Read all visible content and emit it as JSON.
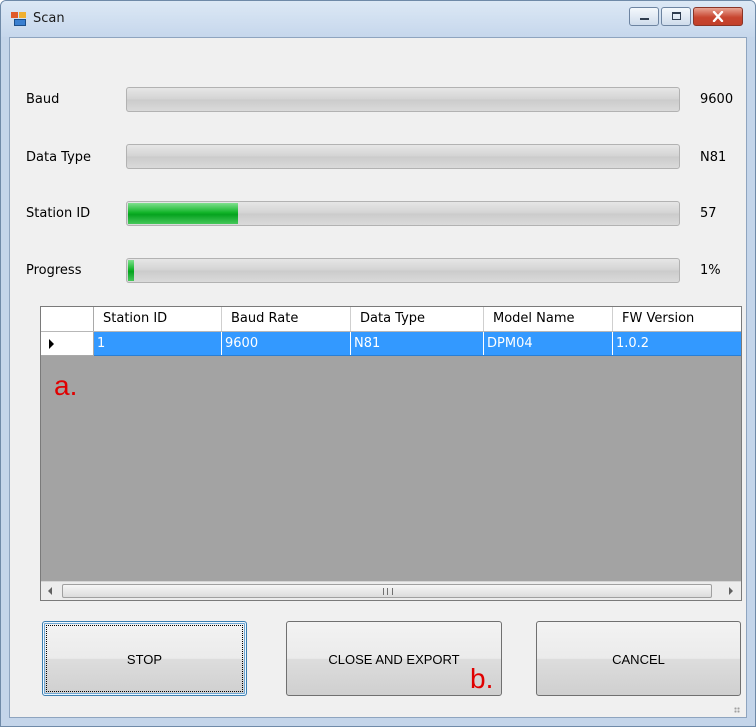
{
  "window": {
    "title": "Scan"
  },
  "fields": [
    {
      "label": "Baud",
      "value": "9600",
      "progress": 0
    },
    {
      "label": "Data Type",
      "value": "N81",
      "progress": 0
    },
    {
      "label": "Station ID",
      "value": "57",
      "progress": 0.2
    },
    {
      "label": "Progress",
      "value": "1%",
      "progress": 0.01
    }
  ],
  "grid": {
    "columns": [
      "Station ID",
      "Baud Rate",
      "Data Type",
      "Model Name",
      "FW Version"
    ],
    "rows": [
      [
        "1",
        "9600",
        "N81",
        "DPM04",
        "1.0.2"
      ]
    ],
    "scrollbar_grip": "III"
  },
  "buttons": {
    "stop": "STOP",
    "close_export": "CLOSE AND EXPORT",
    "cancel": "CANCEL"
  },
  "annotations": {
    "a": "a.",
    "b": "b."
  },
  "colors": {
    "selection": "#3399ff",
    "progress_green": "#06a31f",
    "annotation_red": "#e00000"
  }
}
